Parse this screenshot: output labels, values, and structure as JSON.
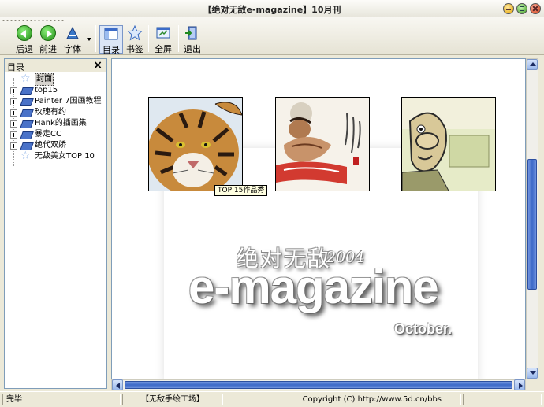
{
  "window": {
    "title": "【绝对无敌e-magazine】10月刊"
  },
  "toolbar": {
    "back_label": "后退",
    "forward_label": "前进",
    "font_label": "字体",
    "toc_label": "目录",
    "bookmark_label": "书签",
    "fullscreen_label": "全屏",
    "exit_label": "退出"
  },
  "sidebar": {
    "title": "目录",
    "close_glyph": "×",
    "items": [
      {
        "label": "封面",
        "icon": "star-page-icon",
        "expandable": false,
        "selected": true
      },
      {
        "label": "top15",
        "icon": "book-icon",
        "expandable": true
      },
      {
        "label": "Painter 7国画教程",
        "icon": "book-icon",
        "expandable": true
      },
      {
        "label": "玫瑰有约",
        "icon": "book-icon",
        "expandable": true
      },
      {
        "label": "Hank的插画集",
        "icon": "book-icon",
        "expandable": true
      },
      {
        "label": "暴走CC",
        "icon": "book-icon",
        "expandable": true
      },
      {
        "label": "绝代双娇",
        "icon": "book-icon",
        "expandable": true
      },
      {
        "label": "无敌美女TOP 10",
        "icon": "star-page-icon",
        "expandable": false
      }
    ]
  },
  "content": {
    "tooltip": "TOP 15作品秀",
    "thumbnails": [
      "tiger-image",
      "warrior-ink-painting",
      "cartoon-character"
    ],
    "logo_cn": "绝对无敌",
    "logo_year": "2004",
    "logo_main": "e-magazine",
    "logo_month": "October."
  },
  "statusbar": {
    "status": "完毕",
    "workshop": "【无敌手绘工场】",
    "copyright": "Copyright (C) http://www.5d.cn/bbs"
  },
  "colors": {
    "titlebar": "#F4F3EE",
    "chrome": "#ECE9D8",
    "scrollbar_accent": "#3C69C8",
    "tooltip_bg": "#FFFFE1"
  }
}
